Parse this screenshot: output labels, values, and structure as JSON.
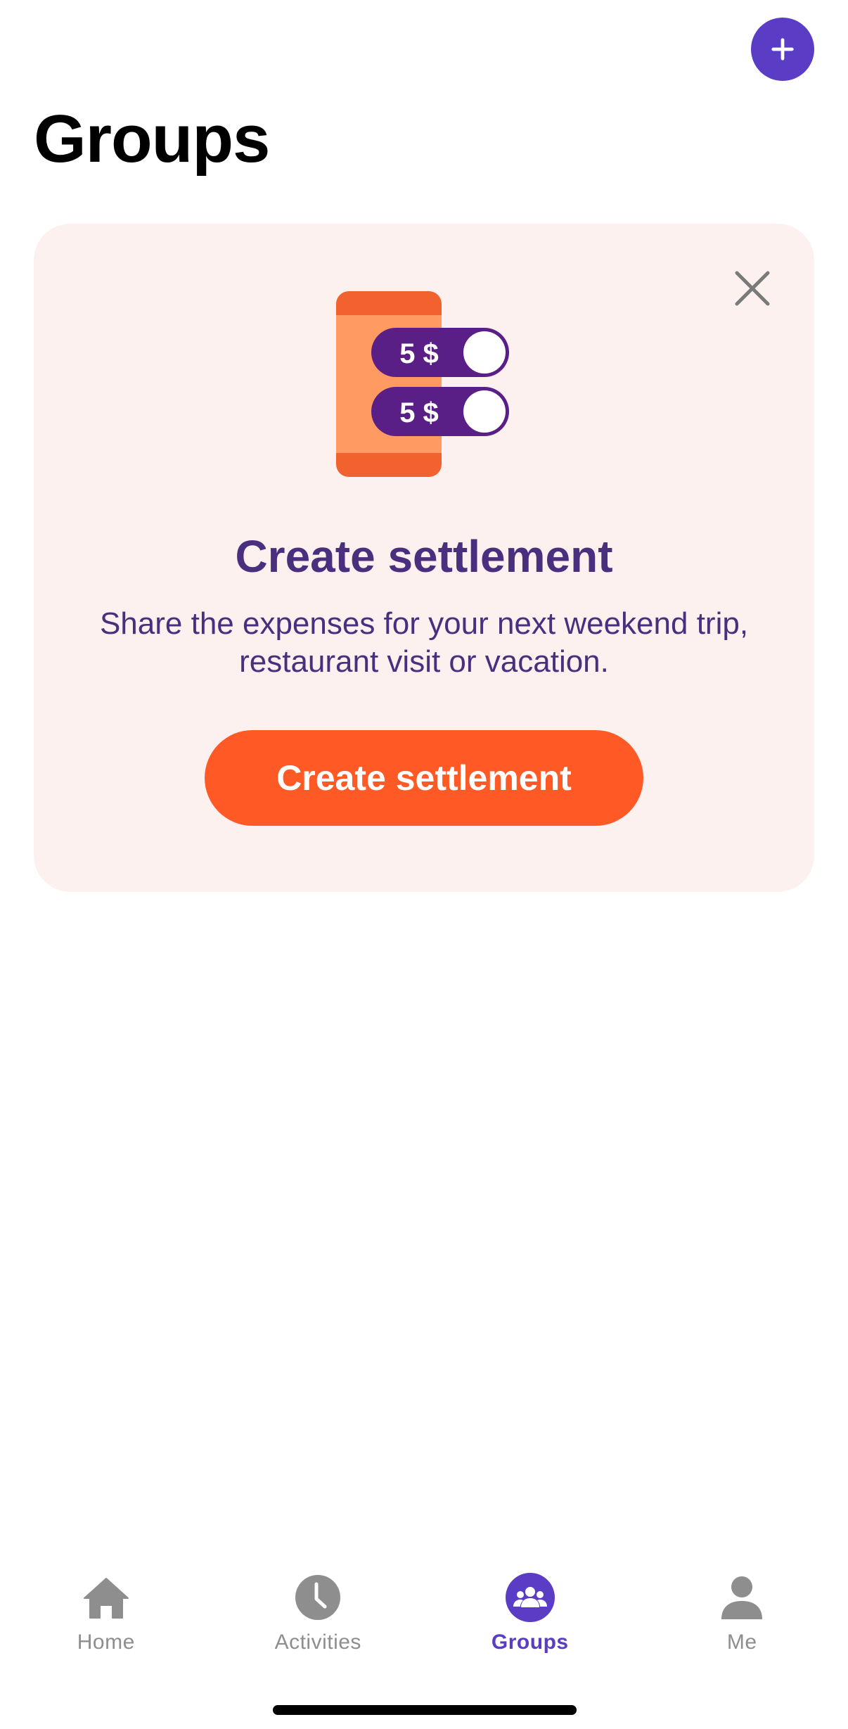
{
  "header": {
    "title": "Groups",
    "add_icon": "plus-icon"
  },
  "promo": {
    "illustration_amounts": [
      "5 $",
      "5 $"
    ],
    "title": "Create settlement",
    "description_line1": "Share the expenses for your next weekend trip,",
    "description_line2": "restaurant visit or vacation.",
    "button_label": "Create settlement",
    "close_icon": "close-icon"
  },
  "tabs": [
    {
      "label": "Home",
      "icon": "home-icon",
      "active": false
    },
    {
      "label": "Activities",
      "icon": "clock-icon",
      "active": false
    },
    {
      "label": "Groups",
      "icon": "groups-icon",
      "active": true
    },
    {
      "label": "Me",
      "icon": "person-icon",
      "active": false
    }
  ],
  "colors": {
    "accent": "#5b3cc4",
    "cta": "#ff5a26",
    "card_bg": "#fdf1ef",
    "heading": "#4a2f7f",
    "inactive_tab": "#8e8e8e"
  }
}
